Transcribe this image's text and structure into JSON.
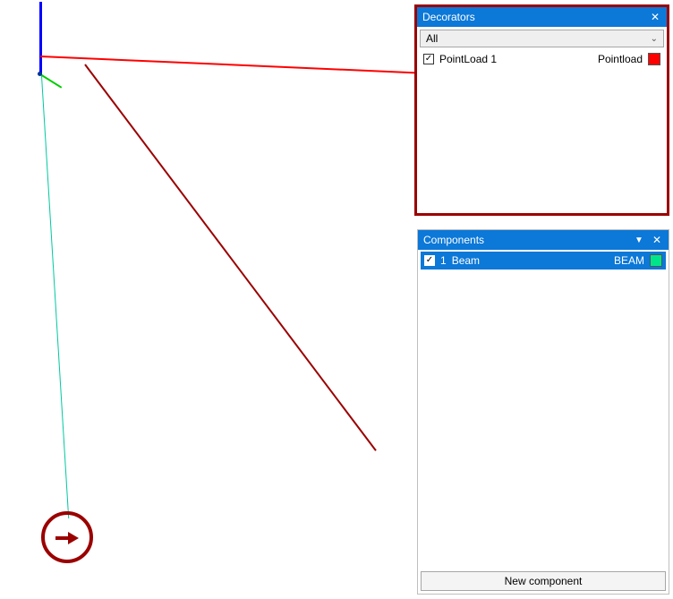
{
  "viewport": {
    "beam_color": "#00c8a0",
    "axis_colors": {
      "x": "#ff0000",
      "y": "#00cc00",
      "z": "#0000ff"
    }
  },
  "decorators_panel": {
    "title": "Decorators",
    "close_glyph": "✕",
    "filter_value": "All",
    "items": [
      {
        "checked": true,
        "name": "PointLoad 1",
        "type_label": "Pointload",
        "swatch": "#ff0000"
      }
    ]
  },
  "components_panel": {
    "title": "Components",
    "close_glyph": "✕",
    "caret_glyph": "▼",
    "items": [
      {
        "checked": true,
        "index": "1",
        "name": "Beam",
        "type_label": "BEAM",
        "swatch": "#00e58a",
        "selected": true
      }
    ],
    "new_button_label": "New component"
  }
}
